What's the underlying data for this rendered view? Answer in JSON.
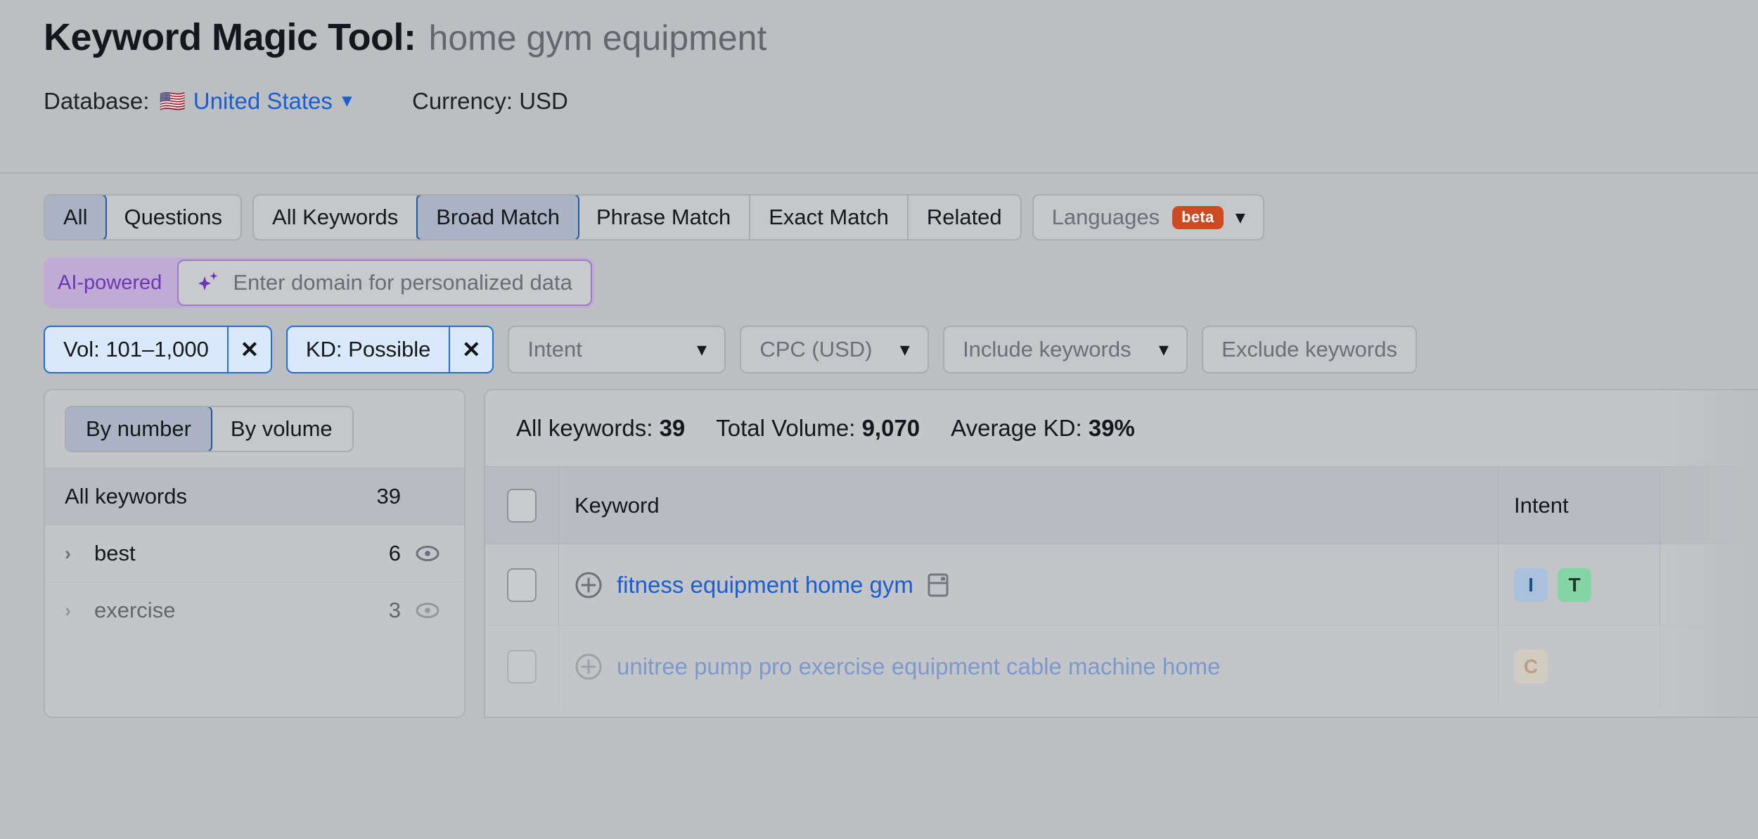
{
  "header": {
    "title_main": "Keyword Magic Tool:",
    "title_query": "home gym equipment",
    "database_label": "Database:",
    "database_flag": "us-flag-icon",
    "database_value": "United States",
    "currency_label": "Currency: USD"
  },
  "tabs": {
    "group1": [
      {
        "label": "All",
        "active": true
      },
      {
        "label": "Questions",
        "active": false
      }
    ],
    "group2": [
      {
        "label": "All Keywords",
        "active": false
      },
      {
        "label": "Broad Match",
        "active": true
      },
      {
        "label": "Phrase Match",
        "active": false
      },
      {
        "label": "Exact Match",
        "active": false
      },
      {
        "label": "Related",
        "active": false
      }
    ],
    "languages": {
      "label": "Languages",
      "badge": "beta"
    }
  },
  "ai_bar": {
    "badge_label": "AI-powered",
    "icon": "sparkle-icon",
    "placeholder": "Enter domain for personalized data",
    "accent": "#6d36b4"
  },
  "filters": [
    {
      "label": "Vol: 101–1,000",
      "active": true,
      "remove": "✕"
    },
    {
      "label": "KD: Possible",
      "active": true,
      "remove": "✕"
    },
    {
      "label": "Intent",
      "active": false
    },
    {
      "label": "CPC (USD)",
      "active": false
    },
    {
      "label": "Include keywords",
      "active": false
    },
    {
      "label": "Exclude keywords",
      "active": false
    }
  ],
  "sidebar": {
    "toggle": [
      {
        "label": "By number",
        "active": true
      },
      {
        "label": "By volume",
        "active": false
      }
    ],
    "items": [
      {
        "name": "All keywords",
        "count": "39",
        "header": true,
        "eye": false
      },
      {
        "name": "best",
        "count": "6",
        "header": false,
        "eye": true
      },
      {
        "name": "exercise",
        "count": "3",
        "header": false,
        "eye": true
      }
    ]
  },
  "results": {
    "summary": {
      "all_keywords_label": "All keywords:",
      "all_keywords_value": "39",
      "total_volume_label": "Total Volume:",
      "total_volume_value": "9,070",
      "average_kd_label": "Average KD:",
      "average_kd_value": "39%"
    },
    "columns": {
      "keyword": "Keyword",
      "intent": "Intent"
    },
    "rows": [
      {
        "keyword": "fitness equipment home gym",
        "intents": [
          "I",
          "T"
        ],
        "serp_icon": "serp-features-icon",
        "faded": false
      },
      {
        "keyword": "unitree pump pro exercise equipment cable machine home",
        "intents": [
          "C"
        ],
        "serp_icon": "",
        "faded": true
      }
    ]
  },
  "colors": {
    "page_bg": "#bcbec2",
    "link_blue": "#1a5fd0",
    "active_border": "#2456a8",
    "chip_border": "#1f6fdd",
    "chip_bg": "#d9e9fb",
    "ai_purple": "#6d36b4",
    "beta_orange": "#cc4a22"
  }
}
